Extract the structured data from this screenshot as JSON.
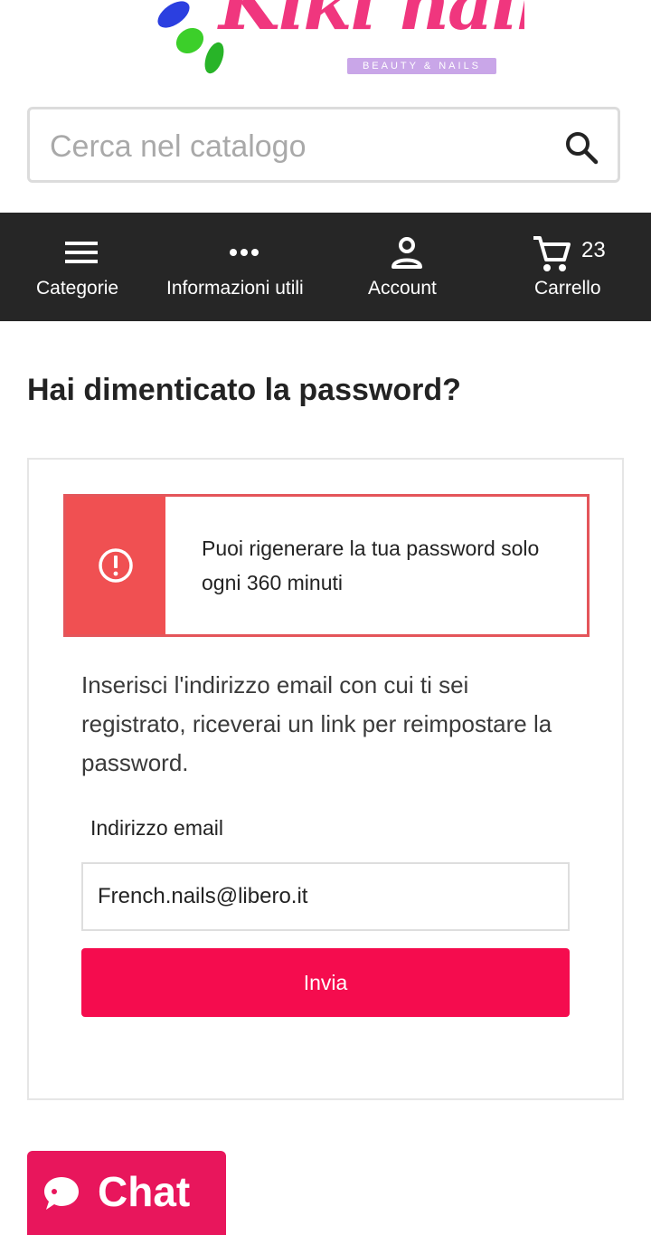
{
  "logo": {
    "text": "Kiki nails",
    "tagline": "BEAUTY & NAILS"
  },
  "search": {
    "placeholder": "Cerca nel catalogo",
    "icon": "search-icon"
  },
  "nav": {
    "items": [
      {
        "label": "Categorie",
        "icon": "menu-icon"
      },
      {
        "label": "Informazioni utili",
        "icon": "more-dots-icon"
      },
      {
        "label": "Account",
        "icon": "user-icon"
      },
      {
        "label": "Carrello",
        "icon": "cart-icon"
      }
    ],
    "cart_count": "23"
  },
  "page": {
    "title": "Hai dimenticato la password?"
  },
  "alert": {
    "message": "Puoi rigenerare la tua password solo ogni 360 minuti",
    "icon": "error-circle-icon",
    "color": "#f05052"
  },
  "form": {
    "help_text": "Inserisci l'indirizzo email con cui ti sei registrato, riceverai un link per reimpostare la password.",
    "email_label": "Indirizzo email",
    "email_value": "French.nails@libero.it",
    "submit_label": "Invia",
    "accent": "#f50c4e"
  },
  "chat": {
    "label": "Chat",
    "icon": "chat-bubble-icon",
    "color": "#e8165c"
  }
}
